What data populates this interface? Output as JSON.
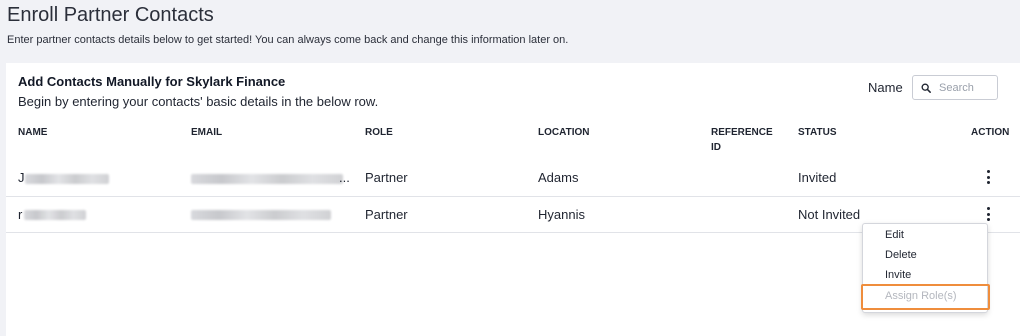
{
  "page": {
    "title": "Enroll Partner Contacts",
    "subtitle": "Enter partner contacts details below to get started! You can always come back and change this information later on."
  },
  "card": {
    "title": "Add Contacts Manually for Skylark Finance",
    "description": "Begin by entering your contacts' basic details in the below row.",
    "search": {
      "label": "Name",
      "placeholder": "Search",
      "icon": "search-icon"
    }
  },
  "table": {
    "headers": {
      "name": "NAME",
      "email": "EMAIL",
      "role": "ROLE",
      "location": "LOCATION",
      "reference_line1": "REFERENCE",
      "reference_line2": "ID",
      "status": "STATUS",
      "action": "ACTION"
    },
    "rows": [
      {
        "name": "J",
        "email_suffix": "...",
        "role": "Partner",
        "location": "Adams",
        "reference_id": "",
        "status": "Invited"
      },
      {
        "name": "r",
        "email_suffix": "",
        "role": "Partner",
        "location": "Hyannis",
        "reference_id": "",
        "status": "Not Invited"
      }
    ]
  },
  "action_menu": {
    "items": [
      {
        "label": "Edit",
        "disabled": false
      },
      {
        "label": "Delete",
        "disabled": false
      },
      {
        "label": "Invite",
        "disabled": false
      },
      {
        "label": "Assign Role(s)",
        "disabled": true
      }
    ],
    "highlight_color": "#ef8d3c"
  }
}
